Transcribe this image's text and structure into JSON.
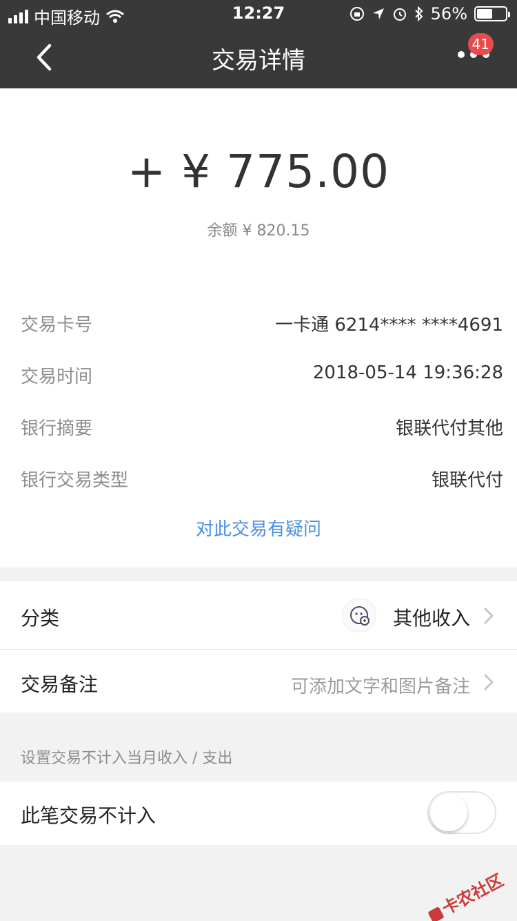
{
  "status_bar": {
    "carrier": "中国移动",
    "time": "12:27",
    "battery": "56%",
    "battery_level": 0.56
  },
  "nav": {
    "title": "交易详情",
    "badge": "41"
  },
  "summary": {
    "amount": "+ ¥ 775.00",
    "balance": "余额 ¥ 820.15"
  },
  "details": [
    {
      "label": "交易卡号",
      "value": "一卡通 6214**** ****4691"
    },
    {
      "label": "交易时间",
      "value": "2018-05-14 19:36:28"
    },
    {
      "label": "银行摘要",
      "value": "银联代付其他"
    },
    {
      "label": "银行交易类型",
      "value": "银联代付"
    }
  ],
  "query_link": "对此交易有疑问",
  "category": {
    "label": "分类",
    "value": "其他收入"
  },
  "note": {
    "label": "交易备注",
    "placeholder": "可添加文字和图片备注"
  },
  "exclude_hint": "设置交易不计入当月收入 / 支出",
  "exclude": {
    "label": "此笔交易不计入",
    "enabled": false
  },
  "watermark": "卡农社区",
  "colors": {
    "header_bg": "#393939",
    "link": "#4a90e2",
    "badge": "#e64c4c"
  }
}
